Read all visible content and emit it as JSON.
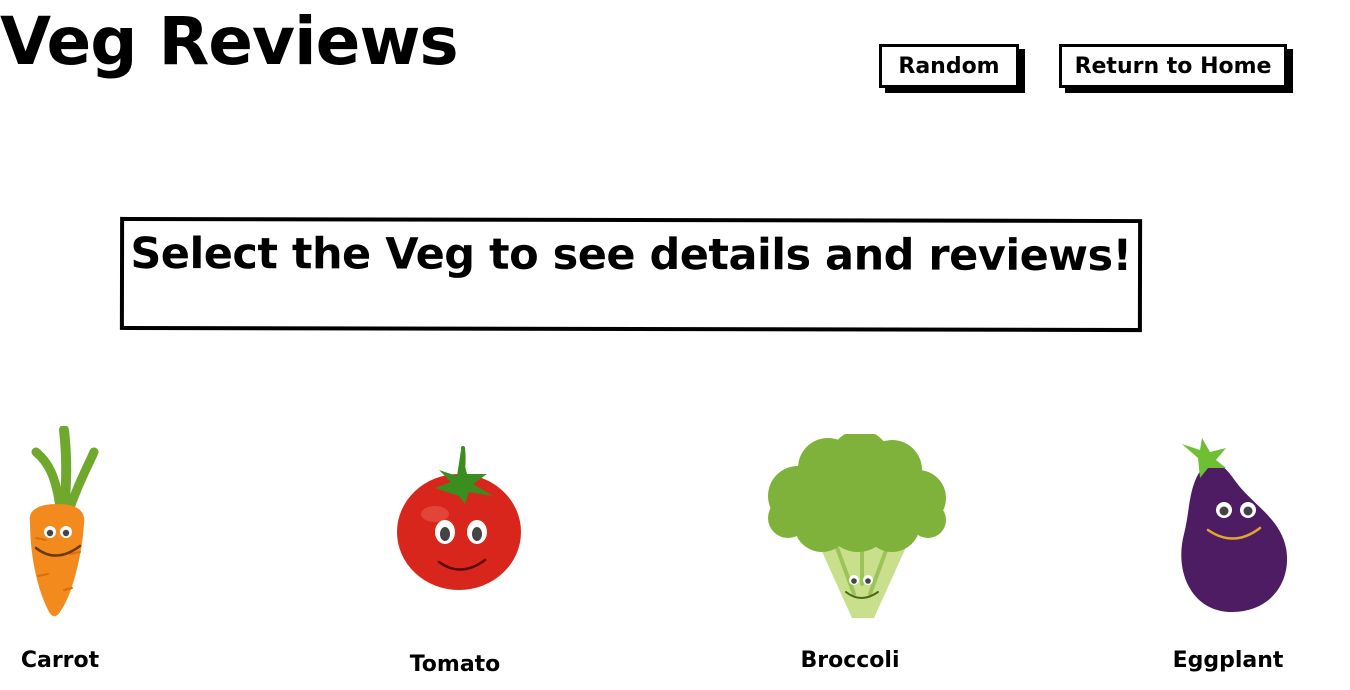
{
  "header": {
    "title": "Veg Reviews",
    "random_label": "Random",
    "home_label": "Return to Home"
  },
  "prompt": {
    "text": "Select the Veg to see details and reviews!"
  },
  "vegetables": [
    {
      "name": "Carrot",
      "icon": "carrot-icon",
      "color": "#f28a1d"
    },
    {
      "name": "Tomato",
      "icon": "tomato-icon",
      "color": "#d9261c"
    },
    {
      "name": "Broccoli",
      "icon": "broccoli-icon",
      "color": "#7fb23a"
    },
    {
      "name": "Eggplant",
      "icon": "eggplant-icon",
      "color": "#4e1c63"
    }
  ]
}
